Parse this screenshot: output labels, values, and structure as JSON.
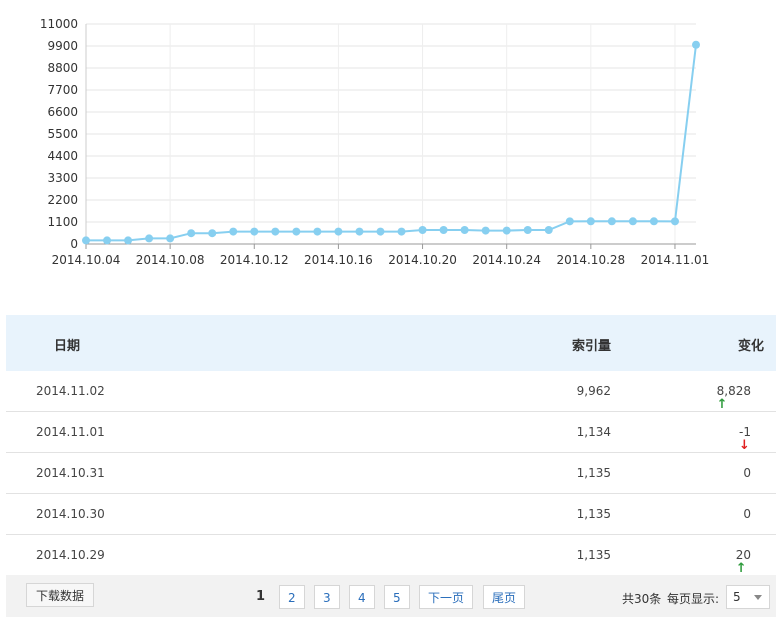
{
  "chart_data": {
    "type": "line",
    "x": [
      "2014.10.04",
      "2014.10.05",
      "2014.10.06",
      "2014.10.07",
      "2014.10.08",
      "2014.10.09",
      "2014.10.10",
      "2014.10.11",
      "2014.10.12",
      "2014.10.13",
      "2014.10.14",
      "2014.10.15",
      "2014.10.16",
      "2014.10.17",
      "2014.10.18",
      "2014.10.19",
      "2014.10.20",
      "2014.10.21",
      "2014.10.22",
      "2014.10.23",
      "2014.10.24",
      "2014.10.25",
      "2014.10.26",
      "2014.10.27",
      "2014.10.28",
      "2014.10.29",
      "2014.10.30",
      "2014.10.31",
      "2014.11.01",
      "2014.11.02"
    ],
    "x_tick_labels": [
      "2014.10.04",
      "2014.10.08",
      "2014.10.12",
      "2014.10.16",
      "2014.10.20",
      "2014.10.24",
      "2014.10.28",
      "2014.11.01"
    ],
    "series": [
      {
        "values": [
          180,
          180,
          180,
          280,
          280,
          540,
          540,
          620,
          620,
          620,
          620,
          620,
          620,
          620,
          620,
          620,
          700,
          700,
          700,
          670,
          670,
          700,
          700,
          1134,
          1135,
          1135,
          1135,
          1135,
          1134,
          9962
        ]
      }
    ],
    "y_ticks": [
      0,
      1100,
      2200,
      3300,
      4400,
      5500,
      6600,
      7700,
      8800,
      9900,
      11000
    ],
    "ylim": [
      0,
      11000
    ],
    "grid": true,
    "line_color": "#87cff0",
    "point_color": "#87cff0"
  },
  "table": {
    "headers": {
      "date": "日期",
      "index": "索引量",
      "change": "变化"
    },
    "rows": [
      {
        "date": "2014.11.02",
        "index": "9,962",
        "change": "8,828",
        "direction": "up"
      },
      {
        "date": "2014.11.01",
        "index": "1,134",
        "change": "-1",
        "direction": "down"
      },
      {
        "date": "2014.10.31",
        "index": "1,135",
        "change": "0",
        "direction": "none"
      },
      {
        "date": "2014.10.30",
        "index": "1,135",
        "change": "0",
        "direction": "none"
      },
      {
        "date": "2014.10.29",
        "index": "1,135",
        "change": "20",
        "direction": "up"
      }
    ]
  },
  "footer": {
    "download_label": "下载数据",
    "current_page": "1",
    "pages": [
      "2",
      "3",
      "4",
      "5"
    ],
    "next_label": "下一页",
    "last_label": "尾页",
    "total_text": "共30条",
    "per_page_label": "每页显示:",
    "per_page_value": "5"
  },
  "colors": {
    "up": "#2e9b3c",
    "down": "#e02020",
    "header_bg": "#e8f3fc",
    "link": "#2a6ebb"
  }
}
